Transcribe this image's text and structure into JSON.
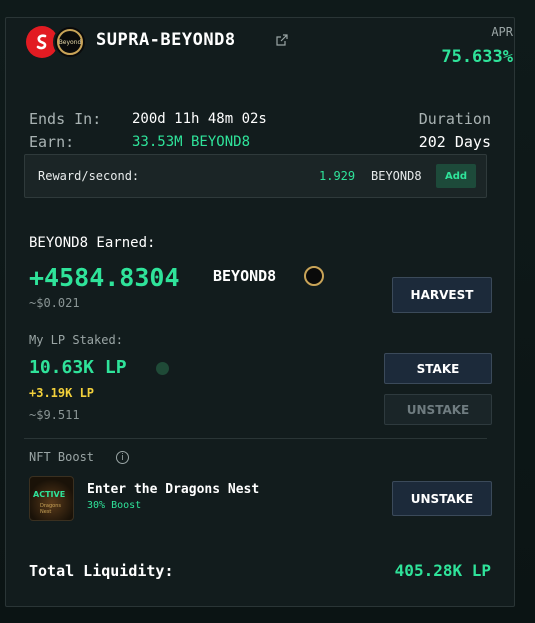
{
  "pool": {
    "title": "SUPRA-BEYOND8",
    "logo2_text": "Beyond",
    "apr_label": "APR",
    "apr_value": "75.633%"
  },
  "meta": {
    "ends_label": "Ends In:",
    "ends_value": "200d 11h 48m 02s",
    "earn_label": "Earn:",
    "earn_value": "33.53M BEYOND8",
    "duration_label": "Duration",
    "duration_value": "202 Days"
  },
  "reward": {
    "label": "Reward/second:",
    "amount": "1.929",
    "token": "BEYOND8",
    "add_label": "Add"
  },
  "earned": {
    "label": "BEYOND8 Earned:",
    "amount": "+4584.8304",
    "token": "BEYOND8",
    "usd": "~$0.021",
    "harvest_label": "HARVEST"
  },
  "staked": {
    "label": "My LP Staked:",
    "amount": "10.63K LP",
    "delta": "+3.19K LP",
    "usd": "~$9.511",
    "stake_label": "STAKE",
    "unstake_label": "UNSTAKE"
  },
  "nft": {
    "section_label": "NFT Boost",
    "thumb_status": "ACTIVE",
    "thumb_name": "Dragons Nest",
    "name": "Enter the Dragons Nest",
    "boost": "30% Boost",
    "unstake_label": "UNSTAKE"
  },
  "liquidity": {
    "label": "Total Liquidity:",
    "value": "405.28K LP"
  },
  "colors": {
    "accent_green": "#2fe39a",
    "warn_yellow": "#f2d03b",
    "supra_red": "#e21b22"
  }
}
